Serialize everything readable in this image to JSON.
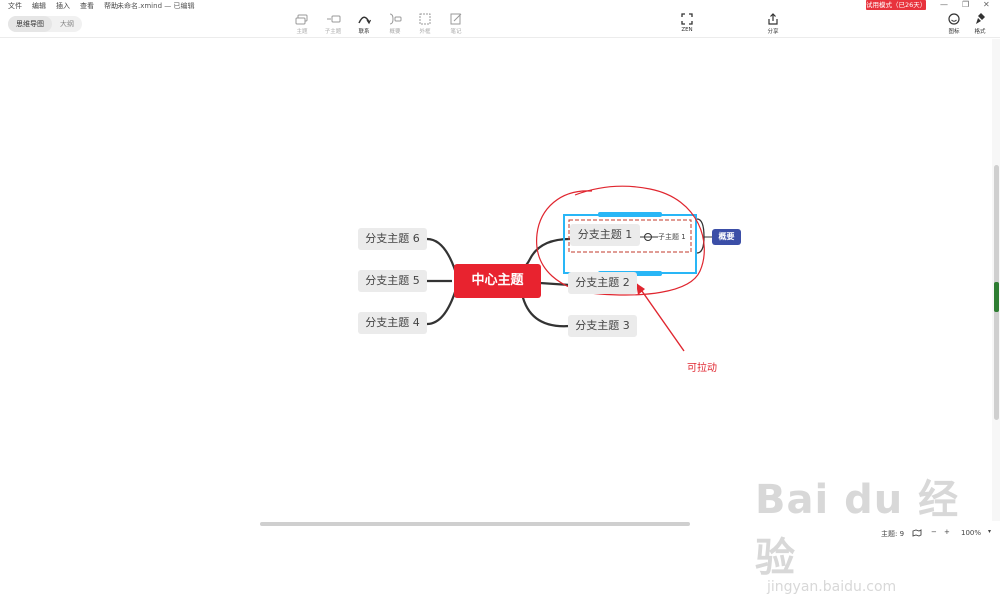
{
  "menu": [
    "文件",
    "编辑",
    "插入",
    "查看",
    "帮助"
  ],
  "doc_title": "未命名.xmind — 已编辑",
  "trial_badge": "试用模式（已26天）",
  "window_controls": [
    "—",
    "❐",
    "✕"
  ],
  "view_tabs": [
    "思维导图",
    "大纲"
  ],
  "tools": [
    {
      "label": "主题",
      "icon": "topic-icon",
      "active": false
    },
    {
      "label": "子主题",
      "icon": "subtopic-icon",
      "active": false
    },
    {
      "label": "联系",
      "icon": "relationship-icon",
      "active": true
    },
    {
      "label": "概要",
      "icon": "summary-icon",
      "active": false
    },
    {
      "label": "外框",
      "icon": "boundary-icon",
      "active": false
    },
    {
      "label": "笔记",
      "icon": "note-icon",
      "active": false
    }
  ],
  "zen_label": "ZEN",
  "share_label": "分享",
  "right_tools": [
    {
      "label": "图标",
      "icon": "smiley-icon"
    },
    {
      "label": "格式",
      "icon": "brush-icon"
    }
  ],
  "mindmap": {
    "center": "中心主题",
    "branches_right": [
      "分支主题 1",
      "分支主题 2",
      "分支主题 3"
    ],
    "branches_left": [
      "分支主题 6",
      "分支主题 5",
      "分支主题 4"
    ],
    "subtopic": "子主题 1",
    "summary": "概要"
  },
  "annotation": "可拉动",
  "status": {
    "topic_count": "主题: 9",
    "zoom": "100%",
    "zoom_out": "−",
    "zoom_in": "+"
  },
  "watermark": {
    "main": "Bai du 经验",
    "sub": "jingyan.baidu.com"
  },
  "colors": {
    "accent_red": "#e8232f",
    "selection_blue": "#29b6f6",
    "summary_blue": "#3b4ea7",
    "annotation_red": "#e0262f"
  }
}
